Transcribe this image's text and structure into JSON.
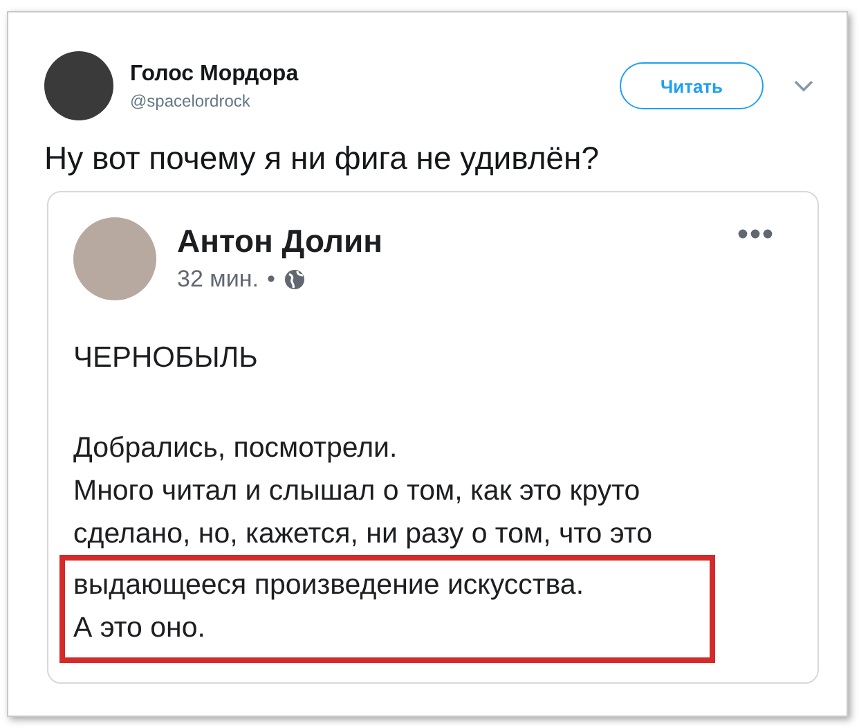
{
  "author": {
    "name": "Голос Мордора",
    "handle": "@spacelordrock"
  },
  "follow_button": "Читать",
  "tweet_text": "Ну вот почему я ни фига не удивлён?",
  "embedded_post": {
    "author": "Антон Долин",
    "time": "32 мин.",
    "separator": "•",
    "title": "ЧЕРНОБЫЛЬ",
    "lines": [
      {
        "text": "Добрались, посмотрели.",
        "highlighted": false
      },
      {
        "text": "Много читал и слышал о том, как это круто",
        "highlighted": false
      },
      {
        "text": "сделано, но, кажется, ни разу о том, что это",
        "highlighted": false
      },
      {
        "text": "выдающееся произведение искусства.",
        "highlighted": true
      },
      {
        "text": "А это оно.",
        "highlighted": true
      }
    ]
  }
}
